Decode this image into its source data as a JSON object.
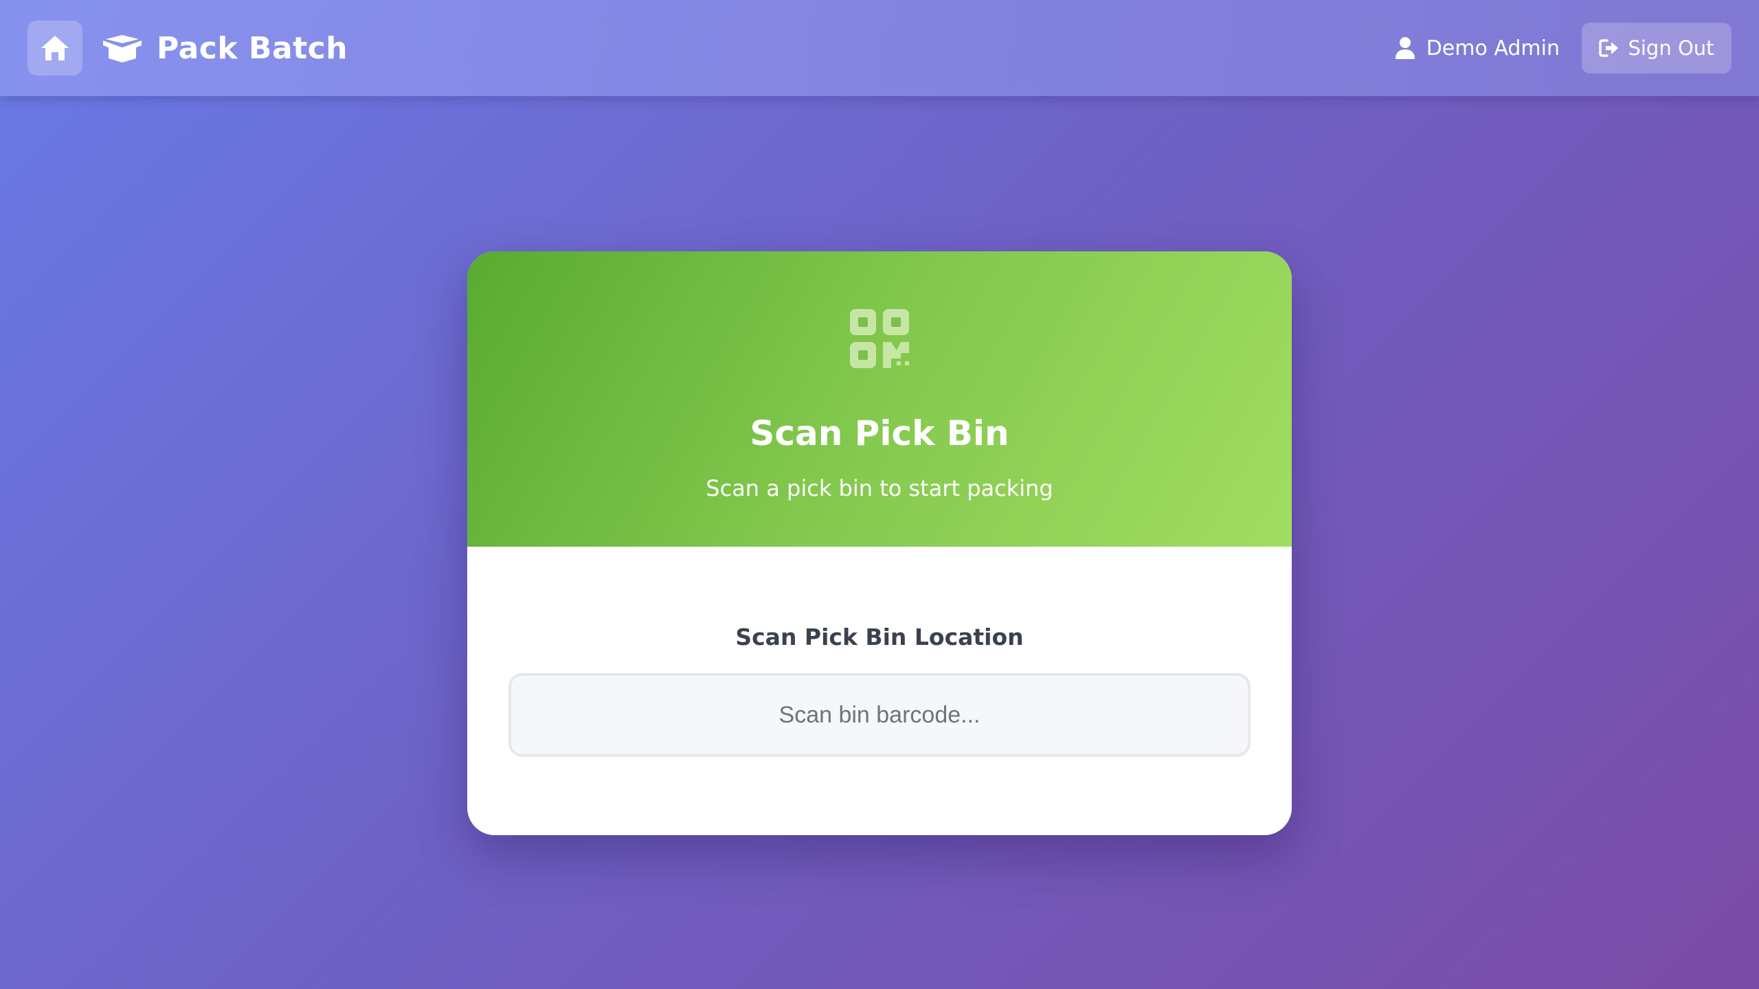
{
  "nav": {
    "home_icon": "home-icon",
    "brand_icon": "box-open-icon",
    "brand_title": "Pack Batch",
    "user_icon": "user-icon",
    "user_name": "Demo Admin",
    "signout_icon": "sign-out-icon",
    "signout_label": "Sign Out"
  },
  "card": {
    "header_icon": "qrcode-icon",
    "title": "Scan Pick Bin",
    "subtitle": "Scan a pick bin to start packing",
    "field_label": "Scan Pick Bin Location",
    "input_value": "",
    "input_placeholder": "Scan bin barcode..."
  },
  "colors": {
    "background_start": "#6a7be6",
    "background_end": "#7a4ba6",
    "header_green_start": "#5aaa32",
    "header_green_end": "#a2dd62",
    "label_text": "#3a4250"
  }
}
